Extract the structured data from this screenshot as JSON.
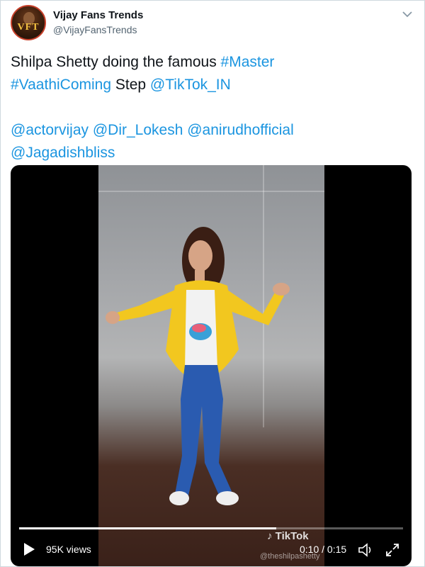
{
  "tweet": {
    "author_name": "Vijay Fans Trends",
    "author_handle": "@VijayFansTrends",
    "avatar_text": "VFT",
    "line1_text": "Shilpa Shetty doing the famous ",
    "line1_link": "#Master",
    "line2_link1": "#VaathiComing",
    "line2_text": " Step ",
    "line2_link2": "@TikTok_IN",
    "mentions_line1": "@actorvijay @Dir_Lokesh @anirudhofficial",
    "mentions_line2": "@Jagadishbliss"
  },
  "video": {
    "views": "95K views",
    "time": "0:10 / 0:15",
    "progress": 0.67,
    "watermark": "TikTok",
    "watermark_user": "@theshilpashetty"
  },
  "icons": {
    "chevron": "chevron-down-icon",
    "play": "play-icon",
    "volume": "volume-icon",
    "fullscreen": "fullscreen-icon"
  },
  "colors": {
    "link": "#1b95e0",
    "text": "#0f1419",
    "secondary": "#536471"
  }
}
